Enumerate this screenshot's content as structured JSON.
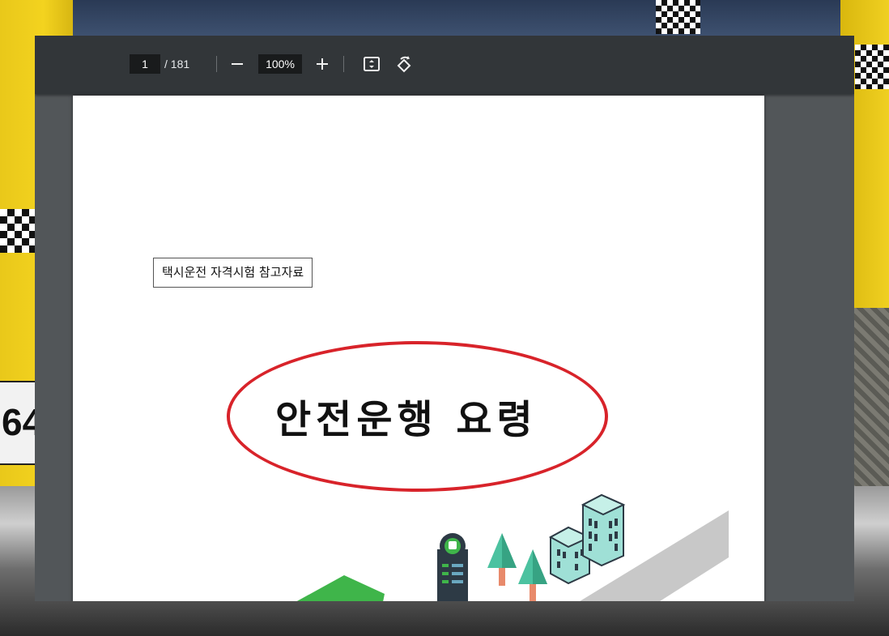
{
  "viewer": {
    "current_page": "1",
    "page_total": "/ 181",
    "zoom": "100%",
    "zoom_out_label": "−",
    "zoom_in_label": "+",
    "icons": [
      "minus-icon",
      "plus-icon",
      "fit-page-icon",
      "rotate-icon"
    ]
  },
  "document": {
    "label": "택시운전 자격시험 참고자료",
    "title": "안전운행 요령"
  },
  "background_photo": {
    "plate_text": "64"
  },
  "colors": {
    "toolbar": "#323639",
    "viewer_bg": "#525659",
    "ellipse": "#d8232a",
    "taxi_yellow": "#f3d31f"
  }
}
